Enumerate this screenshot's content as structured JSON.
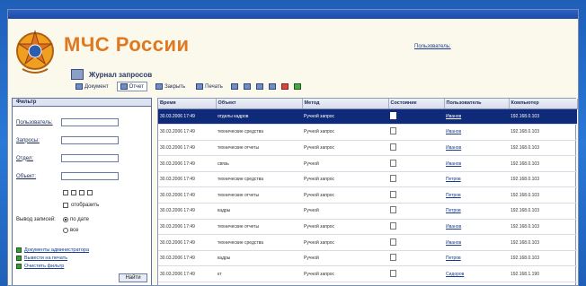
{
  "window": {
    "title": ""
  },
  "header": {
    "brand": "МЧС России",
    "journal_title": "Журнал запросов",
    "user_label": "Пользователь:",
    "user_value": ""
  },
  "toolbar": {
    "items": [
      {
        "label": "Документ"
      },
      {
        "label": "Отчет"
      },
      {
        "label": "Закрыть"
      },
      {
        "label": "Печать"
      }
    ]
  },
  "sidebar": {
    "title": "Фильтр",
    "fields": [
      {
        "label": "Пользователь:"
      },
      {
        "label": "Запросы:"
      },
      {
        "label": "Отдел:"
      },
      {
        "label": "Объект:"
      }
    ],
    "checkbox_label": "отобразить",
    "sort_label": "Вывод записей:",
    "radio_1": "по дате",
    "radio_2": "все",
    "links": [
      {
        "label": "Документы администратора"
      },
      {
        "label": "Вывести на печать"
      },
      {
        "label": "Очистить фильтр"
      }
    ],
    "apply_label": "Найти"
  },
  "table": {
    "columns": [
      "Время",
      "Объект",
      "Метод",
      "Состояние",
      "Пользователь",
      "Компьютер"
    ],
    "rows": [
      {
        "time": "30.03.2006 17:49",
        "object": "отделы кадров",
        "method": "Ручной запрос",
        "user": "Иванов",
        "computer": "192.168.0.103",
        "selected": true
      },
      {
        "time": "30.03.2006 17:49",
        "object": "технические средства",
        "method": "Ручной запрос",
        "user": "Иванов",
        "computer": "192.168.0.103"
      },
      {
        "time": "30.03.2006 17:49",
        "object": "технические отчеты",
        "method": "Ручной запрос",
        "user": "Иванов",
        "computer": "192.168.0.103"
      },
      {
        "time": "30.03.2006 17:49",
        "object": "связь",
        "method": "Ручной",
        "user": "Иванов",
        "computer": "192.168.0.103"
      },
      {
        "time": "30.03.2006 17:49",
        "object": "технические средства",
        "method": "Ручной запрос",
        "user": "Петров",
        "computer": "192.168.0.103"
      },
      {
        "time": "30.03.2006 17:49",
        "object": "технические отчеты",
        "method": "Ручной запрос",
        "user": "Петров",
        "computer": "192.168.0.103"
      },
      {
        "time": "30.03.2006 17:49",
        "object": "кадры",
        "method": "Ручной",
        "user": "Петров",
        "computer": "192.168.0.103"
      },
      {
        "time": "30.03.2006 17:49",
        "object": "технические отчеты",
        "method": "Ручной запрос",
        "user": "Иванов",
        "computer": "192.168.0.103"
      },
      {
        "time": "30.03.2006 17:49",
        "object": "технические средства",
        "method": "Ручной запрос",
        "user": "Иванов",
        "computer": "192.168.0.103"
      },
      {
        "time": "30.03.2006 17:49",
        "object": "кадры",
        "method": "Ручной",
        "user": "Петров",
        "computer": "192.168.0.103"
      },
      {
        "time": "30.03.2006 17:49",
        "object": "кт",
        "method": "Ручной запрос",
        "user": "Сидоров",
        "computer": "192.168.1.190"
      }
    ]
  },
  "colors": {
    "brand": "#e07820",
    "selected_row": "#102a7a",
    "desktop": "#2a78d8"
  }
}
